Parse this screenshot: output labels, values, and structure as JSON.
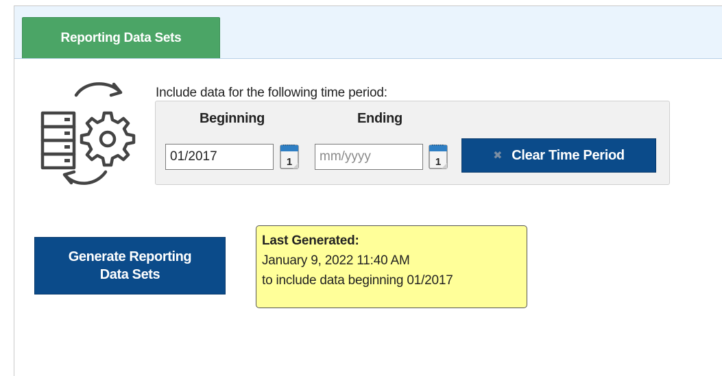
{
  "tab": {
    "label": "Reporting Data Sets"
  },
  "time_period": {
    "label": "Include data for the following time period:",
    "beginning_header": "Beginning",
    "ending_header": "Ending",
    "beginning_value": "01/2017",
    "ending_value": "",
    "ending_placeholder": "mm/yyyy",
    "clear_button": "Clear Time Period",
    "calendar_day": "1"
  },
  "generate_button": {
    "line1": "Generate Reporting",
    "line2": "Data Sets"
  },
  "last_generated": {
    "title": "Last Generated:",
    "timestamp": "January 9, 2022 11:40 AM",
    "note": "to include data beginning 01/2017"
  },
  "colors": {
    "tab_green": "#4ba566",
    "button_blue": "#0b4b8a",
    "tabbar_bg": "#eaf4fd",
    "note_yellow": "#ffff99"
  },
  "icons": [
    "data-sets-sync-icon",
    "calendar-icon",
    "close-icon"
  ]
}
